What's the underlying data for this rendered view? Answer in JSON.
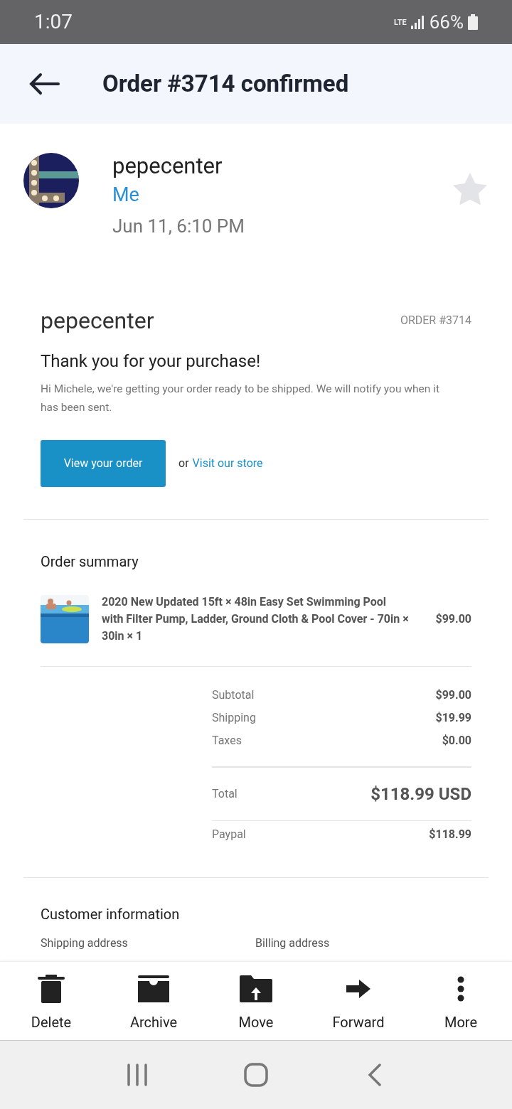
{
  "status_bar": {
    "time": "1:07",
    "network": "LTE",
    "battery": "66%"
  },
  "header": {
    "title": "Order #3714 confirmed"
  },
  "message": {
    "sender": "pepecenter",
    "recipient": "Me",
    "date": "Jun 11, 6:10 PM",
    "starred": false
  },
  "email": {
    "store_name": "pepecenter",
    "order_label": "ORDER #3714",
    "heading": "Thank you for your purchase!",
    "body": "Hi Michele, we're getting your order ready to be shipped. We will notify you when it has been sent.",
    "primary_button": "View your order",
    "or_text": "or",
    "link": "Visit our store"
  },
  "order_summary": {
    "title": "Order summary",
    "items": [
      {
        "title": "2020 New Updated 15ft × 48in Easy Set Swimming Pool with Filter Pump, Ladder, Ground Cloth & Pool Cover - 70in × 30in × 1",
        "price": "$99.00"
      }
    ],
    "totals": [
      {
        "label": "Subtotal",
        "value": "$99.00"
      },
      {
        "label": "Shipping",
        "value": "$19.99"
      },
      {
        "label": "Taxes",
        "value": "$0.00"
      }
    ],
    "total": {
      "label": "Total",
      "value": "$118.99 USD"
    },
    "payment": {
      "label": "Paypal",
      "value": "$118.99"
    }
  },
  "customer_information": {
    "title": "Customer information",
    "columns": [
      "Shipping address",
      "Billing address"
    ]
  },
  "toolbar": [
    {
      "kind": "delete",
      "label": "Delete"
    },
    {
      "kind": "archive",
      "label": "Archive"
    },
    {
      "kind": "move",
      "label": "Move"
    },
    {
      "kind": "forward",
      "label": "Forward"
    },
    {
      "kind": "more",
      "label": "More"
    }
  ]
}
